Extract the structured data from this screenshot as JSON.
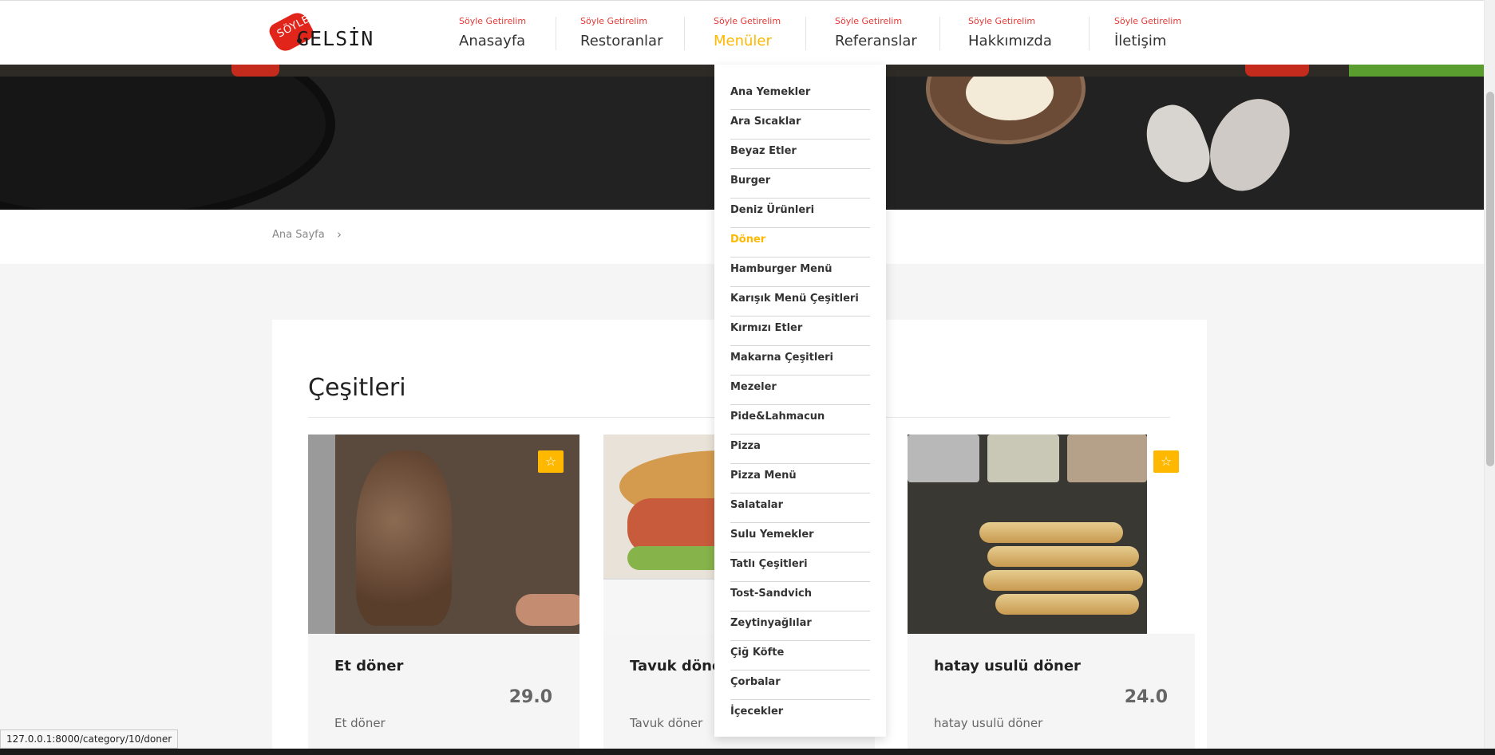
{
  "brand": {
    "badge": "SÖYLE",
    "word": "GELSİN"
  },
  "nav": [
    {
      "sub": "Söyle Getirelim",
      "label": "Anasayfa"
    },
    {
      "sub": "Söyle Getirelim",
      "label": "Restoranlar"
    },
    {
      "sub": "Söyle Getirelim",
      "label": "Menüler",
      "active": true
    },
    {
      "sub": "Söyle Getirelim",
      "label": "Referanslar"
    },
    {
      "sub": "Söyle Getirelim",
      "label": "Hakkımızda"
    },
    {
      "sub": "Söyle Getirelim",
      "label": "İletişim"
    }
  ],
  "breadcrumb": {
    "home": "Ana Sayfa",
    "separator": "›"
  },
  "section": {
    "title": "Çeşitleri"
  },
  "products": [
    {
      "name": "Et döner",
      "price": "29.0",
      "desc": "Et döner"
    },
    {
      "name": "Tavuk döner",
      "price": "",
      "desc": "Tavuk döner"
    },
    {
      "name": "hatay usulü döner",
      "price": "24.0",
      "desc": "hatay usulü döner"
    }
  ],
  "menu_dropdown": {
    "items": [
      "Ana Yemekler",
      "Ara Sıcaklar",
      "Beyaz Etler",
      "Burger",
      "Deniz Ürünleri",
      "Döner",
      "Hamburger Menü",
      "Karışık Menü Çeşitleri",
      "Kırmızı Etler",
      "Makarna Çeşitleri",
      "Mezeler",
      "Pide&Lahmacun",
      "Pizza",
      "Pizza Menü",
      "Salatalar",
      "Sulu Yemekler",
      "Tatlı Çeşitleri",
      "Tost-Sandvich",
      "Zeytinyağlılar",
      "Çiğ Köfte",
      "Çorbalar",
      "İçecekler"
    ],
    "active_item": "Döner"
  },
  "status_url": "127.0.0.1:8000/category/10/doner",
  "icons": {
    "favorite": "star-icon"
  },
  "colors": {
    "accent": "#ffb800",
    "brand_red": "#e1251b",
    "nav_sub": "#e53935"
  }
}
